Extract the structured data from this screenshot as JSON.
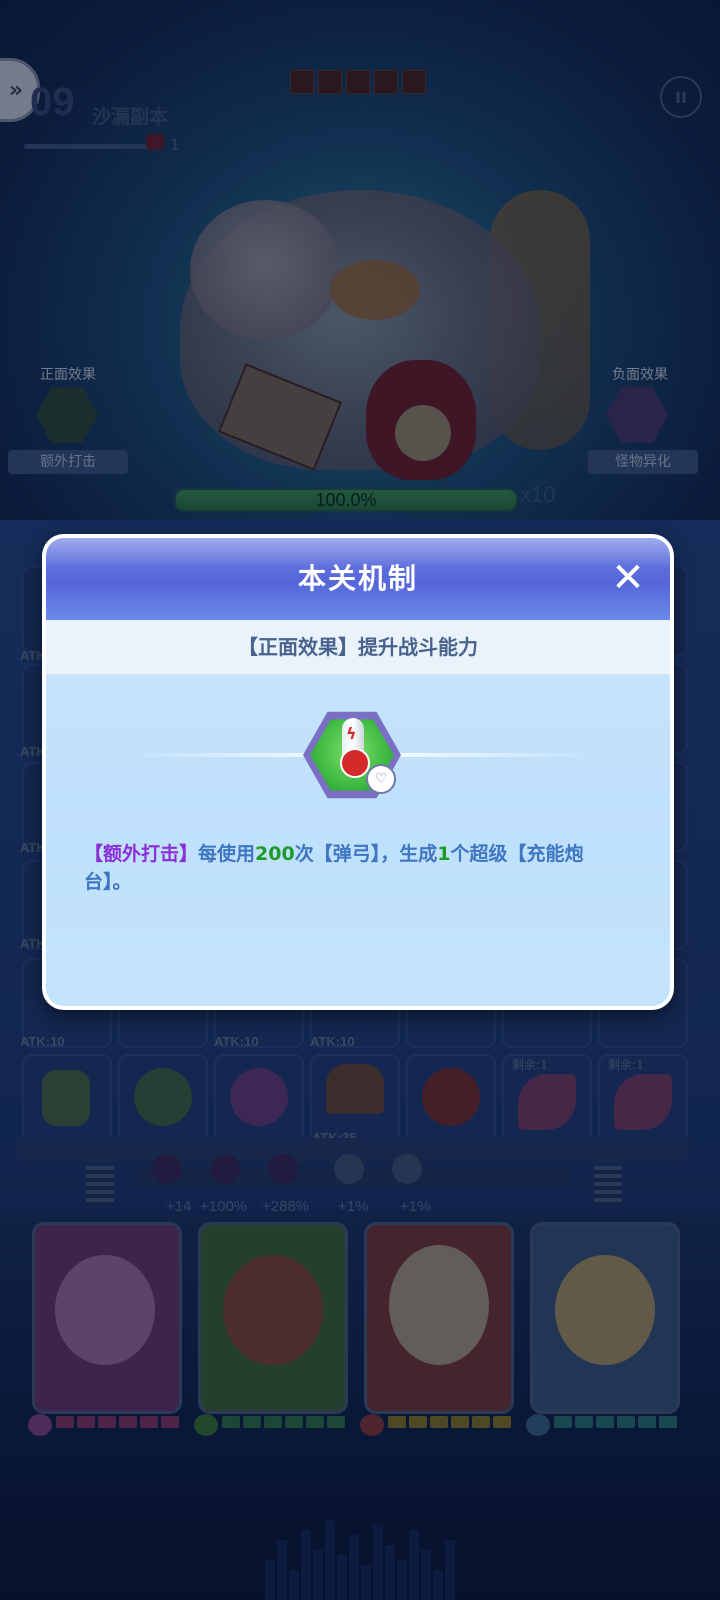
{
  "hud": {
    "level_number": "09",
    "level_name": "沙漏副本",
    "level_count": "1",
    "pause_icon": "pause-icon",
    "back_icon": "double-chevron-icon"
  },
  "effects": {
    "positive": {
      "label": "正面效果",
      "name": "额外打击"
    },
    "negative": {
      "label": "负面效果",
      "name": "怪物异化"
    }
  },
  "boss": {
    "hp_percent": "100.0%",
    "hp_fraction": 1.0,
    "multiplier": "x10"
  },
  "grid": {
    "atk_labels": [
      "ATK",
      "ATK",
      "ATK",
      "ATK",
      "ATK",
      "ATK:10",
      "ATK:10",
      "ATK:10",
      "ATK:35"
    ],
    "remain_labels": [
      "剩余:1",
      "剩余:1"
    ]
  },
  "buffs": [
    "+14",
    "+100%",
    "+288%",
    "+1%",
    "+1%"
  ],
  "modal": {
    "title": "本关机制",
    "close_icon": "close-icon",
    "subtitle": "【正面效果】提升战斗能力",
    "desc": {
      "p1": "【额外打击】",
      "p2": "每使用",
      "p3": "200",
      "p4": "次【弹弓】，生成",
      "p5": "1",
      "p6": "个超级【充能炮台】。"
    }
  },
  "colors": {
    "modal_header": "#5566d8",
    "highlight_purple": "#8a2fd6",
    "highlight_green": "#1e9a2a",
    "desc_blue": "#3f76c2"
  }
}
